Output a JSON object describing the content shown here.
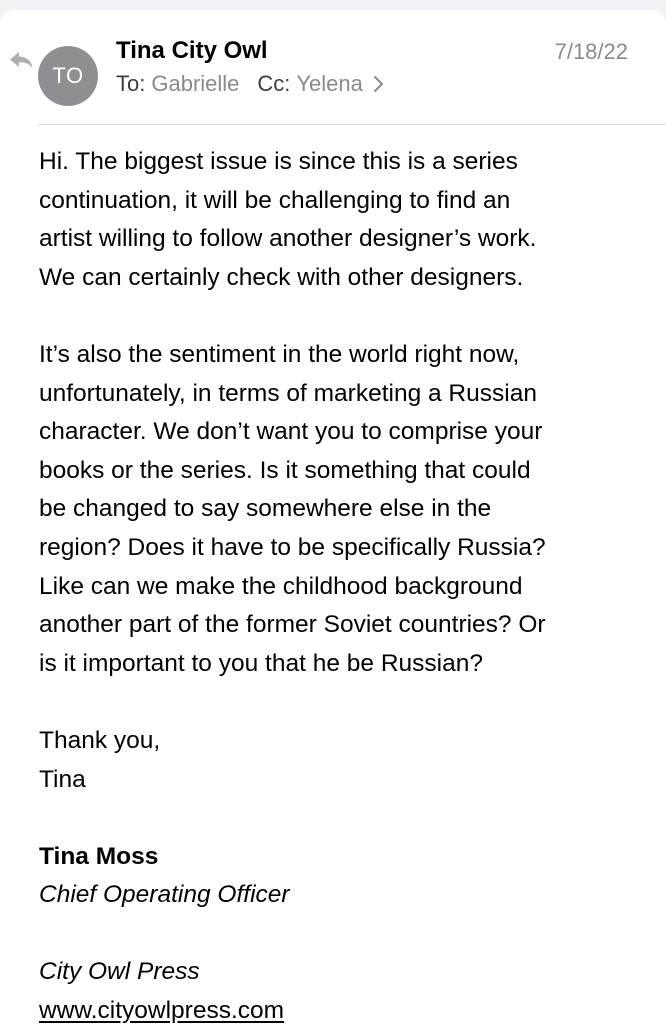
{
  "header": {
    "avatar_initials": "TO",
    "sender_name": "Tina City Owl",
    "date": "7/18/22",
    "to_label": "To:",
    "to_value": "Gabrielle",
    "cc_label": "Cc:",
    "cc_value": "Yelena",
    "icons": {
      "reply": "reply-arrow-icon",
      "expand": "chevron-right-icon"
    }
  },
  "body": {
    "lines": [
      "Hi. The biggest issue is since this is a series",
      "continuation, it will be challenging to find an",
      "artist willing to follow another designer’s work.",
      "We can certainly check with other designers.",
      "",
      "It’s also the sentiment in the world right now,",
      "unfortunately, in terms of marketing a Russian",
      "character. We don’t want you to comprise your",
      "books or the series. Is it something that could",
      "be changed to say somewhere else in the",
      "region? Does it have to be specifically Russia?",
      "Like can we make the childhood background",
      "another part of the former Soviet countries? Or",
      "is it important to you that he be Russian?",
      "",
      "Thank you,",
      "Tina"
    ]
  },
  "signature": {
    "name": "Tina Moss",
    "title": "Chief Operating Officer",
    "company": "City Owl Press",
    "website": "www.cityowlpress.com"
  },
  "colors": {
    "page_background": "#f2f2f7",
    "card_background": "#ffffff",
    "avatar_background": "#8e8e93",
    "secondary_text": "#8a8a8e",
    "divider": "#d8d8dc"
  }
}
